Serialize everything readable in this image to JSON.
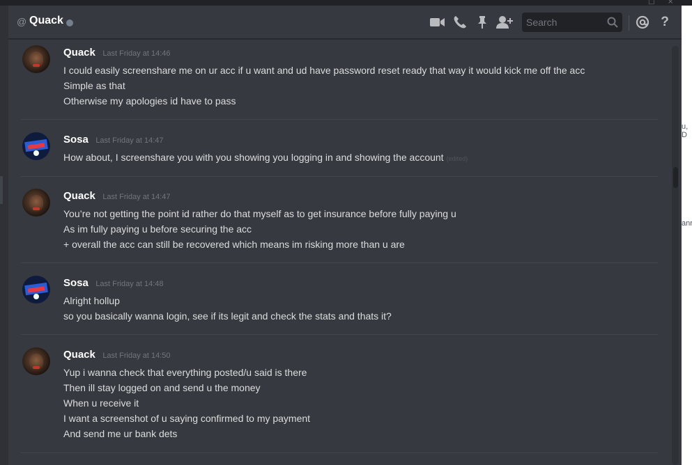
{
  "header": {
    "at_symbol": "@",
    "channel_name": "Quack",
    "search_placeholder": "Search",
    "help_label": "?"
  },
  "colors": {
    "background": "#36393f",
    "header_border": "#26282c",
    "username": "#ffffff",
    "message_text": "#dcddde",
    "timestamp": "#72767d",
    "status_offline": "#747f8d"
  },
  "icons": [
    "video-call-icon",
    "voice-call-icon",
    "pin-icon",
    "add-friend-icon",
    "search-icon",
    "mention-icon",
    "help-icon"
  ],
  "messages": [
    {
      "author": "Quack",
      "timestamp": "Last Friday at 14:46",
      "lines": [
        "I could easily screenshare me on ur acc if u want and ud have password reset ready that way it would kick me off the acc",
        "Simple as that",
        "Otherwise my apologies id have to pass"
      ]
    },
    {
      "author": "Sosa",
      "timestamp": "Last Friday at 14:47",
      "lines": [
        "How about, I screenshare you with you showing you logging in and showing the account"
      ],
      "edited_label": "(edited)"
    },
    {
      "author": "Quack",
      "timestamp": "Last Friday at 14:47",
      "lines": [
        "You’re not getting the point id rather do that myself as to get insurance before fully paying u",
        "As im fully paying u before securing the acc",
        "+ overall the acc can still be recovered which means im risking more than u are"
      ]
    },
    {
      "author": "Sosa",
      "timestamp": "Last Friday at 14:48",
      "lines": [
        "Alright hollup",
        "so you basically wanna login, see if its legit and check the stats and thats it?"
      ]
    },
    {
      "author": "Quack",
      "timestamp": "Last Friday at 14:50",
      "lines": [
        "Yup i wanna check that everything posted/u said is there",
        "Then ill stay logged on and send u the money",
        "When u receive it",
        "I want a screenshot of u saying confirmed to my payment",
        "And send me ur bank dets"
      ]
    }
  ],
  "side_fragments": {
    "frag_1": "u, D",
    "frag_2": "anr"
  }
}
